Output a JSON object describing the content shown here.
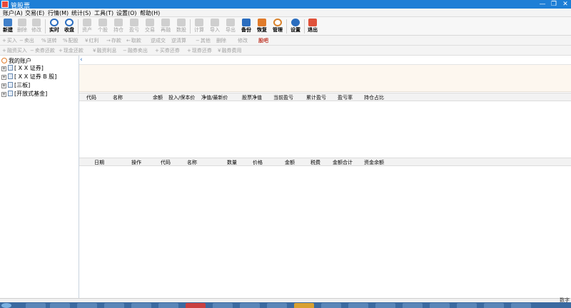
{
  "window": {
    "title": "管股票"
  },
  "menu": [
    "账户(A)",
    "交易(E)",
    "行情(M)",
    "统计(S)",
    "工具(T)",
    "设置(O)",
    "帮助(H)"
  ],
  "toolbar": [
    {
      "label": "新建",
      "enabled": true,
      "color": "#3f7fc9"
    },
    {
      "label": "删除",
      "enabled": false
    },
    {
      "label": "修改",
      "enabled": false
    },
    {
      "label": "实时",
      "enabled": true,
      "color": "#2a6dbf"
    },
    {
      "label": "收盘",
      "enabled": true,
      "color": "#2a6dbf"
    },
    {
      "label": "资产",
      "enabled": false
    },
    {
      "label": "个股",
      "enabled": false
    },
    {
      "label": "持仓",
      "enabled": false
    },
    {
      "label": "盈亏",
      "enabled": false
    },
    {
      "label": "交易",
      "enabled": false
    },
    {
      "label": "再融",
      "enabled": false
    },
    {
      "label": "数股",
      "enabled": false
    },
    {
      "label": "计算",
      "enabled": false
    },
    {
      "label": "导入",
      "enabled": false
    },
    {
      "label": "导出",
      "enabled": false
    },
    {
      "label": "备份",
      "enabled": true,
      "color": "#2a6dbf"
    },
    {
      "label": "恢复",
      "enabled": true,
      "color": "#e07b2a"
    },
    {
      "label": "管理",
      "enabled": true,
      "color": "#d9822b"
    },
    {
      "label": "设置",
      "enabled": true,
      "color": "#2a6dbf"
    },
    {
      "label": "退出",
      "enabled": true,
      "color": "#e0523a"
    }
  ],
  "actions_row1": [
    {
      "prefix": "+",
      "label": "买入"
    },
    {
      "prefix": "−",
      "label": "卖出"
    },
    {
      "prefix": "%",
      "label": "送转"
    },
    {
      "prefix": "%",
      "label": "配股"
    },
    {
      "prefix": "¥",
      "label": "红利"
    },
    {
      "prefix": "→",
      "label": "存款"
    },
    {
      "prefix": "←",
      "label": "取款"
    },
    {
      "prefix": "",
      "label": "逆成交"
    },
    {
      "prefix": "",
      "label": "逆清算"
    },
    {
      "prefix": "−",
      "label": "其他"
    },
    {
      "prefix": "",
      "label": "删除"
    },
    {
      "prefix": "",
      "label": "修改"
    },
    {
      "prefix": "",
      "label": "股吧",
      "enabled": true
    }
  ],
  "actions_row2": [
    {
      "prefix": "+",
      "label": "融资买入"
    },
    {
      "prefix": "−",
      "label": "卖券还款"
    },
    {
      "prefix": "+",
      "label": "现金还款"
    },
    {
      "prefix": "¥",
      "label": "融资利息"
    },
    {
      "prefix": "−",
      "label": "融券卖出"
    },
    {
      "prefix": "+",
      "label": "买券还券"
    },
    {
      "prefix": "+",
      "label": "现券还券"
    },
    {
      "prefix": "¥",
      "label": "融券费用"
    }
  ],
  "tree": {
    "root": "我的账户",
    "items": [
      "[ X X 证券]",
      "[ X X 证券 B 股]",
      "[三板]",
      "[开放式基金]"
    ]
  },
  "holdings_table": {
    "columns": [
      "代码",
      "名称",
      "余额",
      "投入/保本价",
      "净值/最新价",
      "股票净值",
      "当前盈亏",
      "累计盈亏",
      "盈亏率",
      "持仓占比"
    ]
  },
  "trades_table": {
    "columns": [
      "日期",
      "操作",
      "代码",
      "名称",
      "数量",
      "价格",
      "金额",
      "税费",
      "金额合计",
      "资金余额"
    ]
  },
  "status": {
    "right_text": "数字"
  }
}
